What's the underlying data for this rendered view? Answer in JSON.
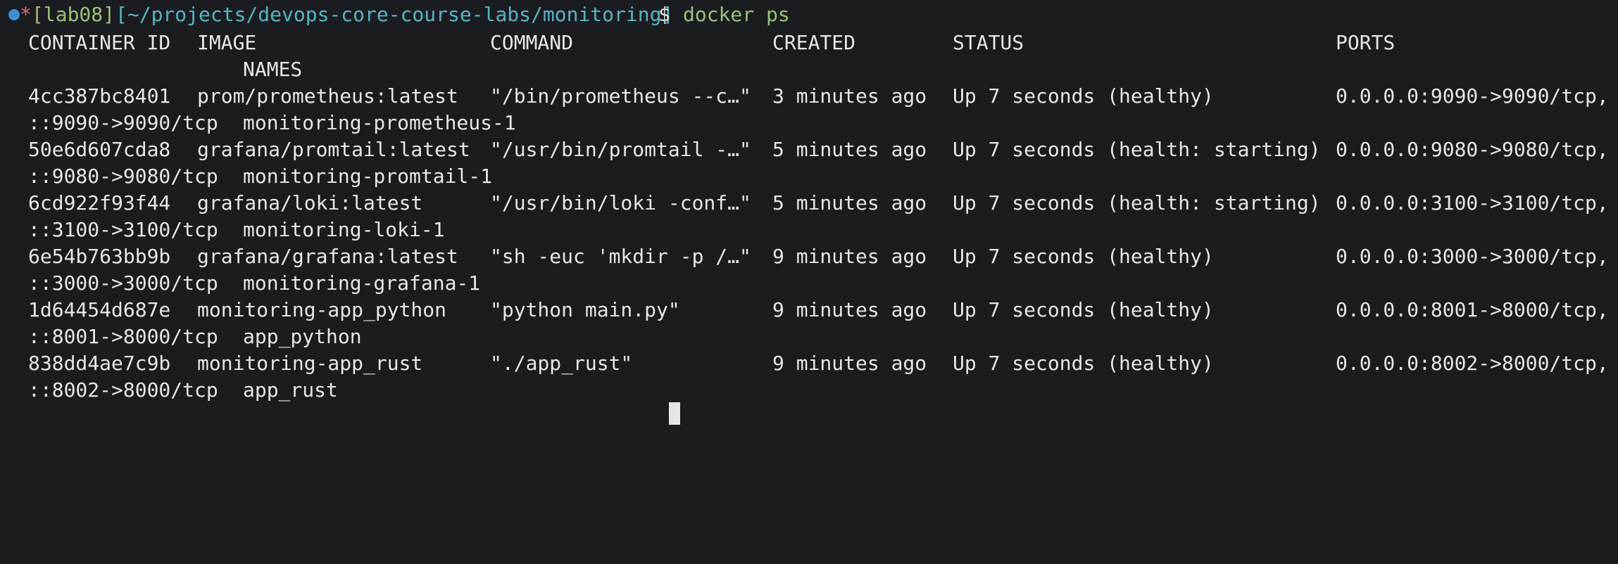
{
  "prompt": {
    "star": "*",
    "branch": "[lab08]",
    "path": "[~/projects/devops-core-course-labs/monitoring]",
    "dollar": "$",
    "command": "docker ps"
  },
  "headers": {
    "container_id": "CONTAINER ID",
    "image": "IMAGE",
    "command": "COMMAND",
    "created": "CREATED",
    "status": "STATUS",
    "ports": "PORTS",
    "names": "NAMES"
  },
  "rows": [
    {
      "id": "4cc387bc8401",
      "image": "prom/prometheus:latest",
      "command": "\"/bin/prometheus --c…\"",
      "created": "3 minutes ago",
      "status": "Up 7 seconds (healthy)",
      "ports": "0.0.0.0:9090->9090/tcp, :",
      "ports_cont": "::9090->9090/tcp",
      "name": "monitoring-prometheus-1"
    },
    {
      "id": "50e6d607cda8",
      "image": "grafana/promtail:latest",
      "command": "\"/usr/bin/promtail -…\"",
      "created": "5 minutes ago",
      "status": "Up 7 seconds (health: starting)",
      "ports": "0.0.0.0:9080->9080/tcp, :",
      "ports_cont": "::9080->9080/tcp",
      "name": "monitoring-promtail-1"
    },
    {
      "id": "6cd922f93f44",
      "image": "grafana/loki:latest",
      "command": "\"/usr/bin/loki -conf…\"",
      "created": "5 minutes ago",
      "status": "Up 7 seconds (health: starting)",
      "ports": "0.0.0.0:3100->3100/tcp, :",
      "ports_cont": "::3100->3100/tcp",
      "name": "monitoring-loki-1"
    },
    {
      "id": "6e54b763bb9b",
      "image": "grafana/grafana:latest",
      "command": "\"sh -euc 'mkdir -p /…\"",
      "created": "9 minutes ago",
      "status": "Up 7 seconds (healthy)",
      "ports": "0.0.0.0:3000->3000/tcp, :",
      "ports_cont": "::3000->3000/tcp",
      "name": "monitoring-grafana-1"
    },
    {
      "id": "1d64454d687e",
      "image": "monitoring-app_python",
      "command": "\"python main.py\"",
      "created": "9 minutes ago",
      "status": "Up 7 seconds (healthy)",
      "ports": "0.0.0.0:8001->8000/tcp, :",
      "ports_cont": "::8001->8000/tcp",
      "name": "app_python"
    },
    {
      "id": "838dd4ae7c9b",
      "image": "monitoring-app_rust",
      "command": "\"./app_rust\"",
      "created": "9 minutes ago",
      "status": "Up 7 seconds (healthy)",
      "ports": "0.0.0.0:8002->8000/tcp, :",
      "ports_cont": "::8002->8000/tcp",
      "name": "app_rust"
    }
  ]
}
